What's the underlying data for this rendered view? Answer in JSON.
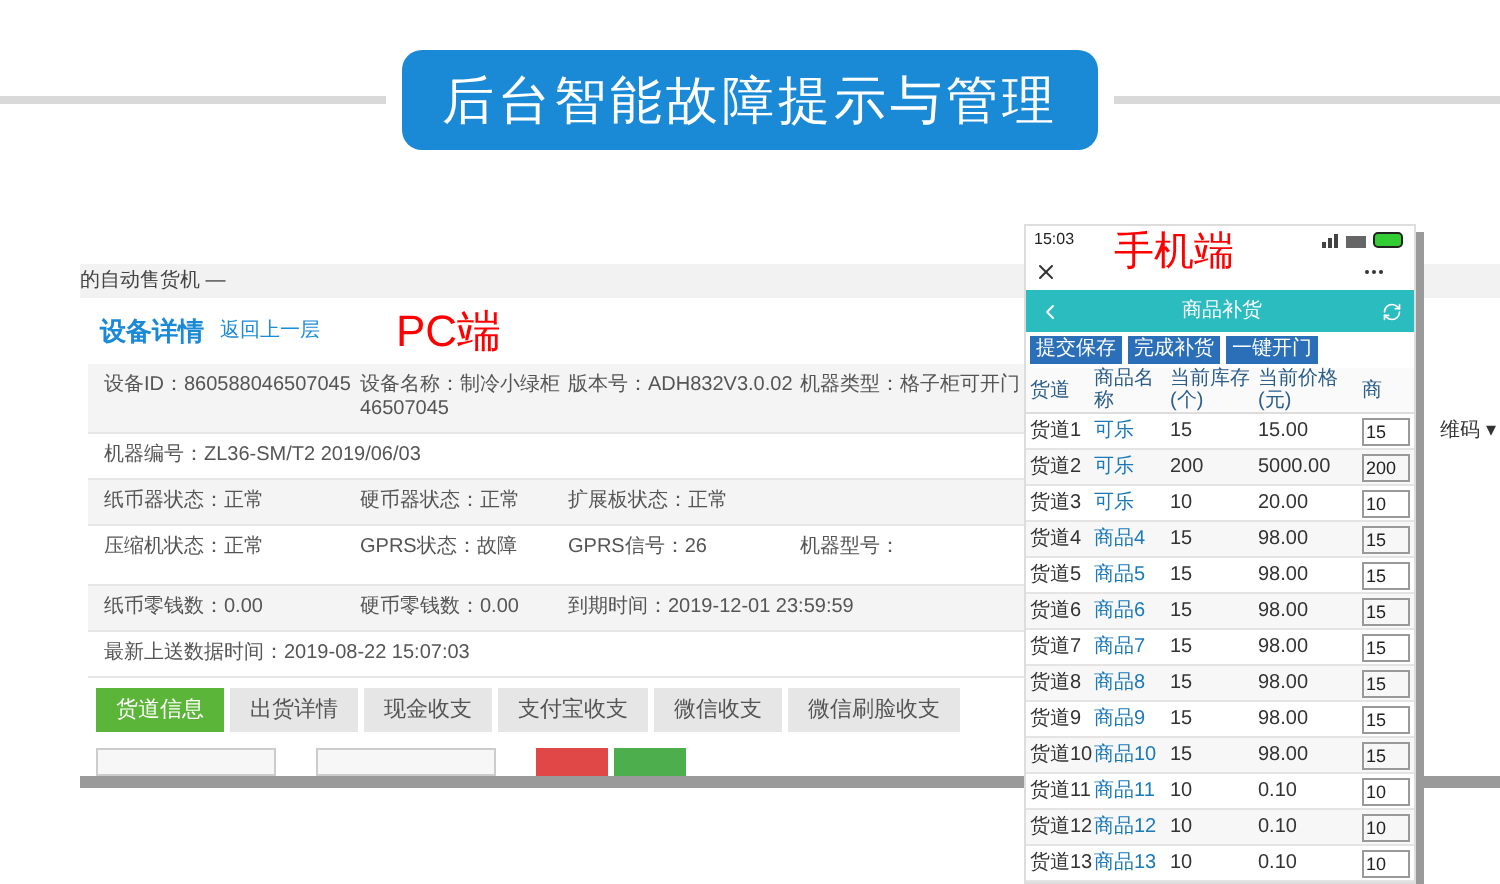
{
  "banner": {
    "title": "后台智能故障提示与管理"
  },
  "pc_window": {
    "breadcrumb": "的自动售货机 —",
    "heading": "设备详情",
    "back_link": "返回上一层",
    "annotation": "PC端",
    "info_rows": [
      [
        "设备ID：860588046507045",
        "设备名称：制冷小绿柜 46507045",
        "版本号：ADH832V3.0.02",
        "机器类型：格子柜可开门"
      ],
      [
        "机器编号：ZL36-SM/T2 2019/06/03"
      ],
      [
        "纸币器状态：正常",
        "硬币器状态：正常",
        "扩展板状态：正常"
      ],
      [
        "压缩机状态：正常",
        "GPRS状态：故障",
        "GPRS信号：26",
        "机器型号："
      ],
      [
        "纸币零钱数：0.00",
        "硬币零钱数：0.00",
        "到期时间：2019-12-01 23:59:59"
      ],
      [
        "最新上送数据时间：2019-08-22 15:07:03"
      ]
    ],
    "tabs": [
      {
        "label": "货道信息",
        "selected": true
      },
      {
        "label": "出货详情",
        "selected": false
      },
      {
        "label": "现金收支",
        "selected": false
      },
      {
        "label": "支付宝收支",
        "selected": false
      },
      {
        "label": "微信收支",
        "selected": false
      },
      {
        "label": "微信刷脸收支",
        "selected": false
      }
    ],
    "side_dropdown": "维码 ▾"
  },
  "phone": {
    "time": "15:03",
    "annotation": "手机端",
    "title": "商品补货",
    "buttons": [
      "提交保存",
      "完成补货",
      "一键开门"
    ],
    "columns": [
      "货道",
      "商品名称",
      "当前库存(个)",
      "当前价格(元)",
      "商"
    ],
    "rows": [
      {
        "lane": "货道1",
        "product": "可乐",
        "stock": "15",
        "price": "15.00",
        "quantity": "15"
      },
      {
        "lane": "货道2",
        "product": "可乐",
        "stock": "200",
        "price": "5000.00",
        "quantity": "200"
      },
      {
        "lane": "货道3",
        "product": "可乐",
        "stock": "10",
        "price": "20.00",
        "quantity": "10"
      },
      {
        "lane": "货道4",
        "product": "商品4",
        "stock": "15",
        "price": "98.00",
        "quantity": "15"
      },
      {
        "lane": "货道5",
        "product": "商品5",
        "stock": "15",
        "price": "98.00",
        "quantity": "15"
      },
      {
        "lane": "货道6",
        "product": "商品6",
        "stock": "15",
        "price": "98.00",
        "quantity": "15"
      },
      {
        "lane": "货道7",
        "product": "商品7",
        "stock": "15",
        "price": "98.00",
        "quantity": "15"
      },
      {
        "lane": "货道8",
        "product": "商品8",
        "stock": "15",
        "price": "98.00",
        "quantity": "15"
      },
      {
        "lane": "货道9",
        "product": "商品9",
        "stock": "15",
        "price": "98.00",
        "quantity": "15"
      },
      {
        "lane": "货道10",
        "product": "商品10",
        "stock": "15",
        "price": "98.00",
        "quantity": "15"
      },
      {
        "lane": "货道11",
        "product": "商品11",
        "stock": "10",
        "price": "0.10",
        "quantity": "10"
      },
      {
        "lane": "货道12",
        "product": "商品12",
        "stock": "10",
        "price": "0.10",
        "quantity": "10"
      },
      {
        "lane": "货道13",
        "product": "商品13",
        "stock": "10",
        "price": "0.10",
        "quantity": "10"
      }
    ]
  }
}
